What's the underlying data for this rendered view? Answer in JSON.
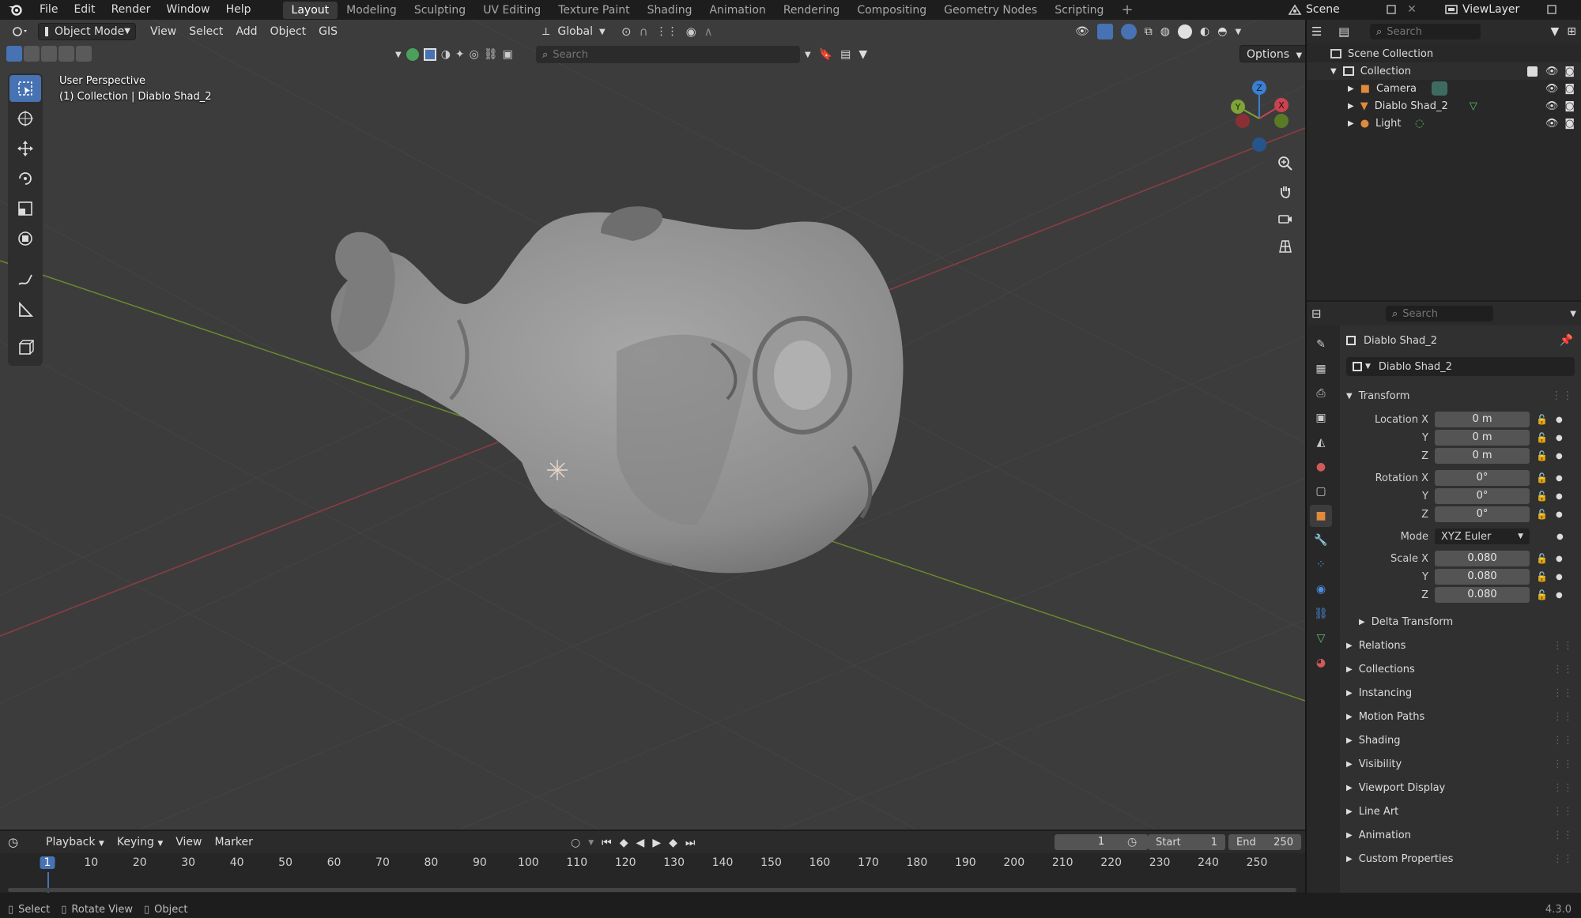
{
  "menubar": {
    "items": [
      "File",
      "Edit",
      "Render",
      "Window",
      "Help"
    ],
    "workspaces": [
      "Layout",
      "Modeling",
      "Sculpting",
      "UV Editing",
      "Texture Paint",
      "Shading",
      "Animation",
      "Rendering",
      "Compositing",
      "Geometry Nodes",
      "Scripting"
    ],
    "active_workspace": "Layout",
    "add_tab": "+",
    "scene": "Scene",
    "view_layer": "ViewLayer"
  },
  "viewport": {
    "mode": "Object Mode",
    "menus": [
      "View",
      "Select",
      "Add",
      "Object",
      "GIS"
    ],
    "orientation": "Global",
    "search_placeholder": "Search",
    "options": "Options",
    "overlay_line1": "User Perspective",
    "overlay_line2": "(1) Collection | Diablo Shad_2",
    "gizmo": {
      "x": "X",
      "y": "Y",
      "z": "Z"
    }
  },
  "outliner": {
    "search_placeholder": "Search",
    "root": "Scene Collection",
    "collection": "Collection",
    "items": [
      {
        "label": "Camera",
        "icon": "camera-icon"
      },
      {
        "label": "Diablo Shad_2",
        "icon": "mesh-icon"
      },
      {
        "label": "Light",
        "icon": "light-icon"
      }
    ]
  },
  "properties": {
    "search_placeholder": "Search",
    "object_header": "Diablo Shad_2",
    "object_name": "Diablo Shad_2",
    "transform_title": "Transform",
    "location": {
      "label": "Location X",
      "x": "0 m",
      "y": "0 m",
      "z": "0 m"
    },
    "rotation": {
      "label": "Rotation X",
      "x": "0°",
      "y": "0°",
      "z": "0°"
    },
    "mode_label": "Mode",
    "mode_value": "XYZ Euler",
    "scale": {
      "label": "Scale X",
      "x": "0.080",
      "y": "0.080",
      "z": "0.080"
    },
    "axis_y": "Y",
    "axis_z": "Z",
    "delta_transform": "Delta Transform",
    "panels": [
      "Relations",
      "Collections",
      "Instancing",
      "Motion Paths",
      "Shading",
      "Visibility",
      "Viewport Display",
      "Line Art",
      "Animation",
      "Custom Properties"
    ]
  },
  "timeline": {
    "menus": [
      "Playback",
      "Keying",
      "View",
      "Marker"
    ],
    "current_frame": "1",
    "start_label": "Start",
    "start_value": "1",
    "end_label": "End",
    "end_value": "250",
    "ruler": [
      "1",
      "10",
      "20",
      "30",
      "40",
      "50",
      "60",
      "70",
      "80",
      "90",
      "100",
      "110",
      "120",
      "130",
      "140",
      "150",
      "160",
      "170",
      "180",
      "190",
      "200",
      "210",
      "220",
      "230",
      "240",
      "250"
    ]
  },
  "statusbar": {
    "select": "Select",
    "rotate": "Rotate View",
    "object": "Object",
    "version": "4.3.0"
  },
  "colors": {
    "accent": "#4772b3",
    "x_axis": "#c8444f",
    "y_axis": "#7ea337",
    "z_axis": "#3a7fd1"
  }
}
